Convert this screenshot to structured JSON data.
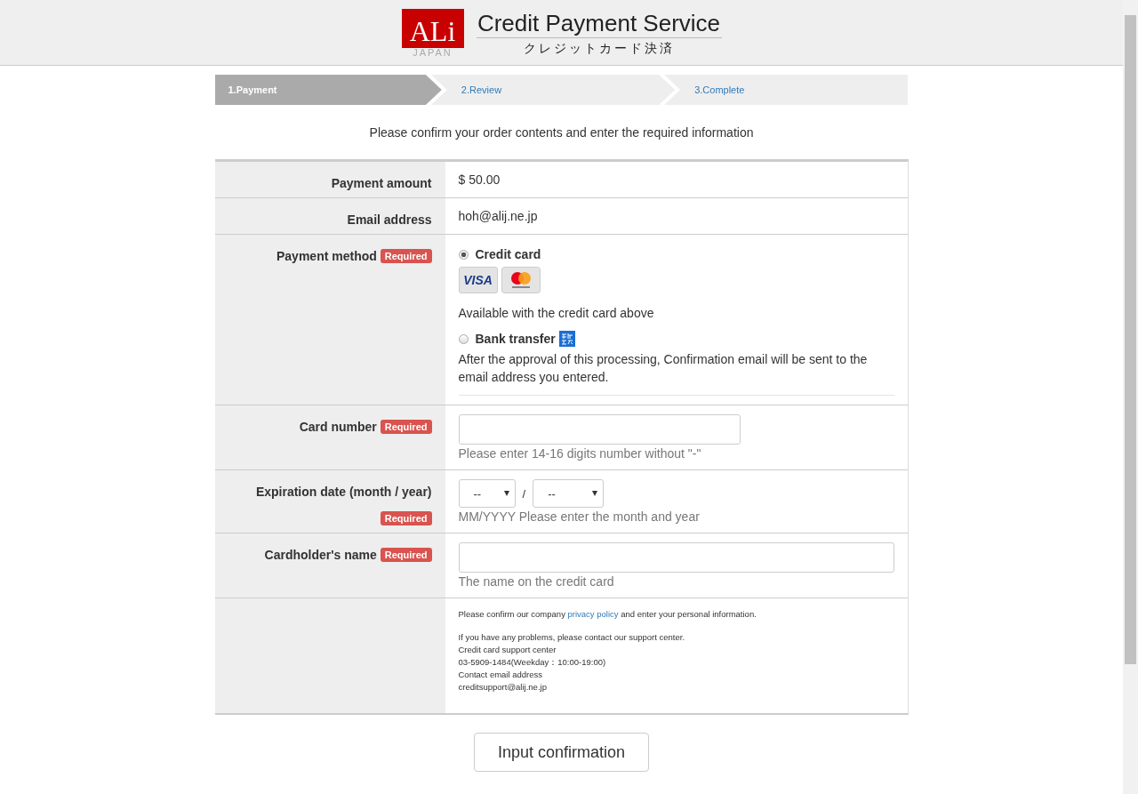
{
  "header": {
    "logo_main": "ALi",
    "logo_sub": "JAPAN",
    "title": "Credit Payment Service",
    "subtitle": "クレジットカード決済"
  },
  "steps": [
    {
      "label": "1.Payment",
      "selected": true
    },
    {
      "label": "2.Review",
      "selected": false
    },
    {
      "label": "3.Complete",
      "selected": false
    }
  ],
  "intro": "Please confirm your order contents and enter the required information",
  "rows": [
    {
      "kind": "text",
      "label": "Payment amount",
      "value": "$ 50.00"
    },
    {
      "kind": "text",
      "label": "Email address",
      "value": "hoh@alij.ne.jp"
    },
    {
      "kind": "payment",
      "label": "Payment method",
      "badge": "Required",
      "options": [
        {
          "kind": "card",
          "label": "Credit card",
          "selected": true,
          "visa": "VISA",
          "note": "Available with the credit card above"
        },
        {
          "kind": "bank",
          "label": "Bank transfer",
          "selected": false,
          "note": "After the approval of this processing, Confirmation email will be sent to the email address you entered."
        }
      ]
    },
    {
      "kind": "input",
      "label": "Card number",
      "badge": "Required",
      "hint": "Please enter 14-16 digits number without \"-\""
    },
    {
      "kind": "expiry",
      "label": "Expiration date (month / year)",
      "badge": "Required",
      "month": "--",
      "separator": "/",
      "year": "--",
      "hint": "MM/YYYY Please enter the month and year"
    },
    {
      "kind": "wideinput",
      "label": "Cardholder's name",
      "badge": "Required",
      "hint": "The name on the credit card"
    },
    {
      "kind": "info",
      "notice": {
        "before": "Please confirm our company",
        "link": "privacy policy",
        "after": "and enter your personal information."
      },
      "lines": [
        "If you have any problems, please contact our support center.",
        "Credit card support center",
        "03-5909-1484(Weekday：10:00-19:00)",
        "Contact email address",
        "creditsupport@alij.ne.jp"
      ]
    }
  ],
  "submit": "Input confirmation"
}
